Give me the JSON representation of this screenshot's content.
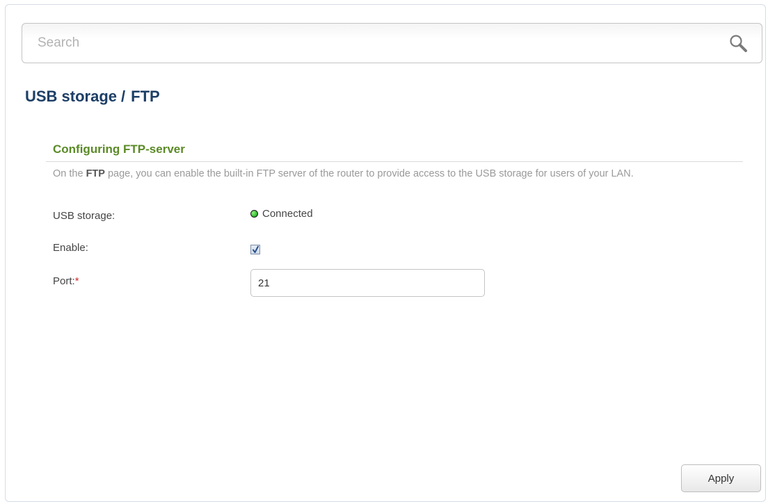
{
  "search": {
    "placeholder": "Search",
    "value": "",
    "icon": "search-icon"
  },
  "header": {
    "breadcrumb_parent": "USB storage",
    "separator": "/",
    "breadcrumb_current": "FTP"
  },
  "section": {
    "title": "Configuring FTP-server",
    "description_prefix": "On the ",
    "description_bold": "FTP",
    "description_suffix": " page, you can enable the built-in FTP server of the router to provide access to the USB storage for users of your LAN."
  },
  "form": {
    "usb_storage": {
      "label": "USB storage:",
      "status": "Connected",
      "status_color": "#2bb52b"
    },
    "enable": {
      "label": "Enable:",
      "checked": true
    },
    "port": {
      "label": "Port:",
      "required_mark": "*",
      "value": "21"
    }
  },
  "actions": {
    "apply_label": "Apply"
  },
  "colors": {
    "title": "#1d3f66",
    "section_title": "#5a8a26",
    "required": "#d42a2a"
  }
}
